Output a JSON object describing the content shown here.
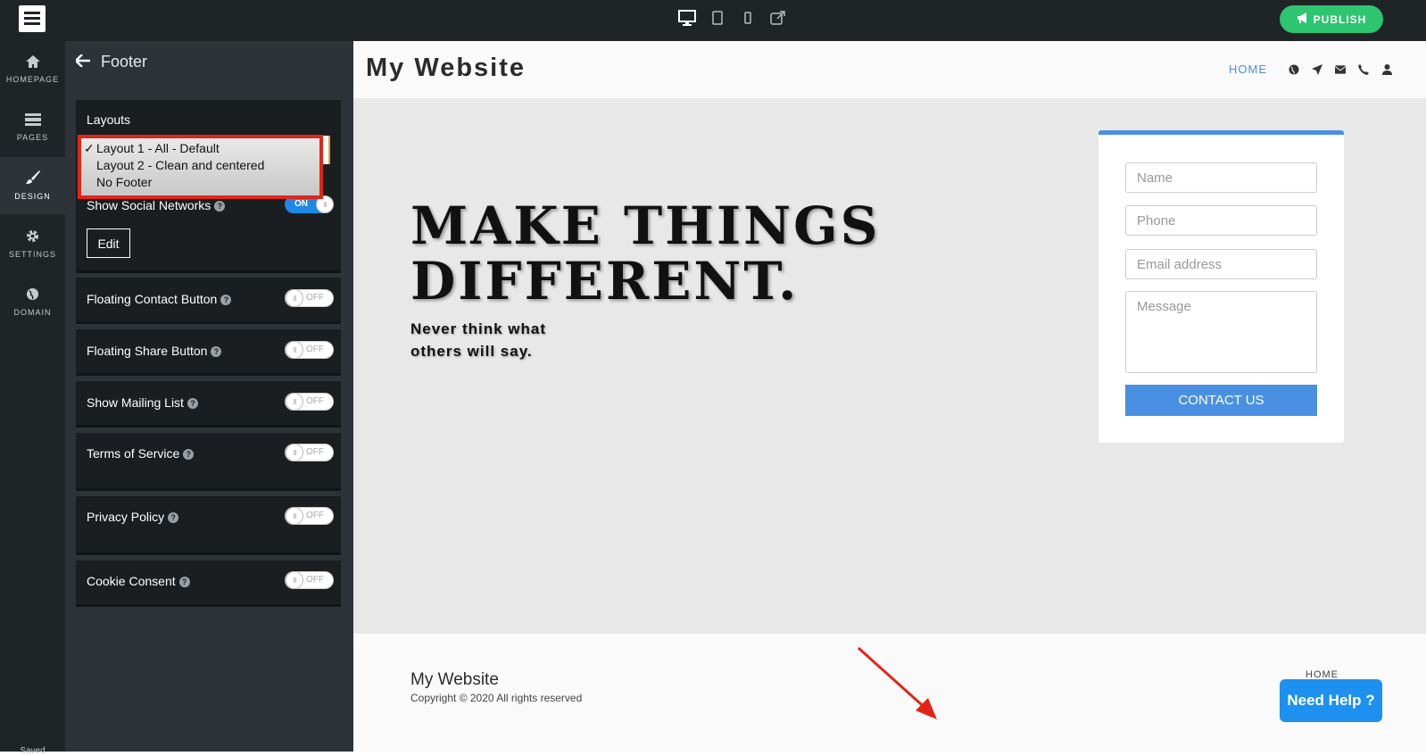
{
  "topbar": {
    "publish_label": "PUBLISH",
    "device_icons": [
      "desktop-icon",
      "tablet-icon",
      "mobile-icon",
      "external-link-icon"
    ]
  },
  "leftnav": {
    "items": [
      {
        "label": "HOMEPAGE",
        "icon": "home-icon"
      },
      {
        "label": "PAGES",
        "icon": "pages-icon"
      },
      {
        "label": "DESIGN",
        "icon": "brush-icon",
        "active": true
      },
      {
        "label": "SETTINGS",
        "icon": "gear-icon"
      },
      {
        "label": "DOMAIN",
        "icon": "globe-icon"
      }
    ],
    "status": "Saved"
  },
  "panel": {
    "title": "Footer",
    "layouts_title": "Layouts",
    "layout_options": [
      "Layout 1 - All - Default",
      "Layout 2 - Clean and centered",
      "No Footer"
    ],
    "selected_layout_mark": "✓",
    "social": {
      "label": "Show Social Networks",
      "state": "ON"
    },
    "edit_label": "Edit",
    "toggles": [
      {
        "label": "Floating Contact Button",
        "state": "OFF"
      },
      {
        "label": "Floating Share Button",
        "state": "OFF"
      },
      {
        "label": "Show Mailing List",
        "state": "OFF"
      },
      {
        "label": "Terms of Service",
        "state": "OFF"
      },
      {
        "label": "Privacy Policy",
        "state": "OFF"
      },
      {
        "label": "Cookie Consent",
        "state": "OFF"
      }
    ]
  },
  "site": {
    "title": "My Website",
    "nav_home": "HOME",
    "nav_icons": [
      "globe-icon",
      "location-arrow-icon",
      "envelope-icon",
      "phone-icon",
      "user-icon"
    ],
    "hero_line1": "MAKE THINGS",
    "hero_line2": "DIFFERENT.",
    "hero_sub1": "Never think what",
    "hero_sub2": "others will say.",
    "form": {
      "name_placeholder": "Name",
      "phone_placeholder": "Phone",
      "email_placeholder": "Email address",
      "message_placeholder": "Message",
      "button_label": "CONTACT US"
    },
    "footer": {
      "title": "My Website",
      "copyright": "Copyright © 2020 All rights reserved",
      "home_link": "HOME"
    }
  },
  "help_widget": "Need Help ?",
  "colors": {
    "accent": "#4a90e2",
    "publish": "#2dc56f",
    "highlight_box": "#e02617",
    "dark_bg": "#1f2427"
  }
}
